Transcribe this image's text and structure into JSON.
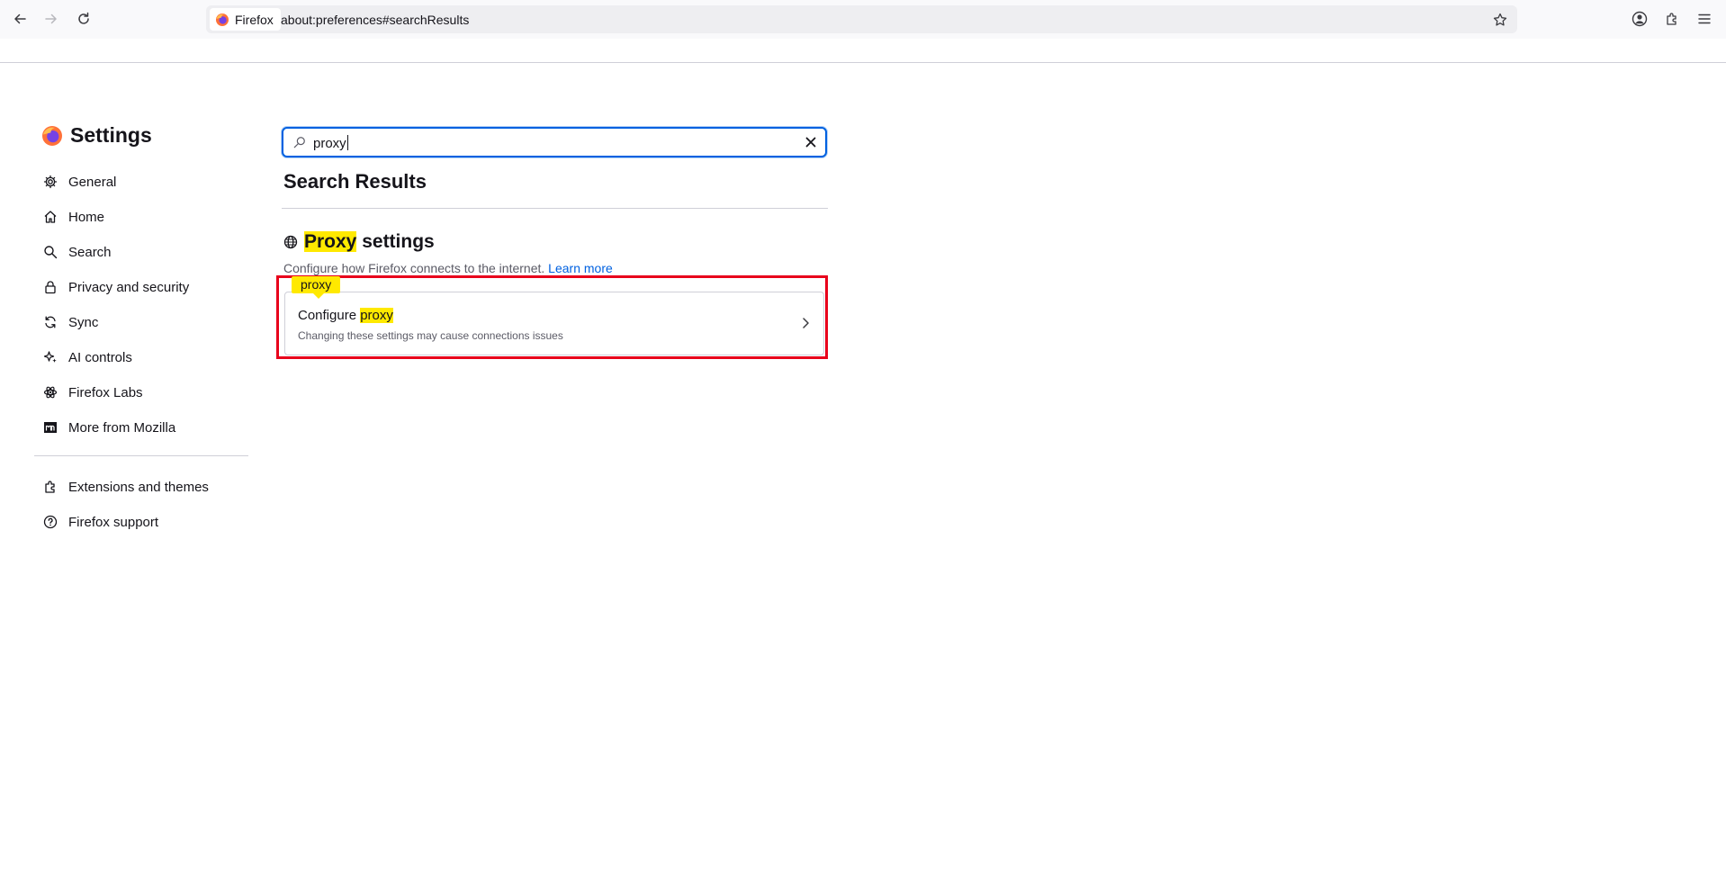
{
  "browser": {
    "identity_label": "Firefox",
    "url": "about:preferences#searchResults"
  },
  "sidebar": {
    "title": "Settings",
    "items": [
      {
        "label": "General",
        "icon": "gear-icon"
      },
      {
        "label": "Home",
        "icon": "home-icon"
      },
      {
        "label": "Search",
        "icon": "search-icon"
      },
      {
        "label": "Privacy and security",
        "icon": "lock-icon"
      },
      {
        "label": "Sync",
        "icon": "sync-icon"
      },
      {
        "label": "AI controls",
        "icon": "sparkle-icon"
      },
      {
        "label": "Firefox Labs",
        "icon": "atom-icon"
      },
      {
        "label": "More from Mozilla",
        "icon": "mozilla-icon"
      }
    ],
    "footer_items": [
      {
        "label": "Extensions and themes",
        "icon": "puzzle-icon"
      },
      {
        "label": "Firefox support",
        "icon": "help-icon"
      }
    ]
  },
  "search": {
    "value": "proxy"
  },
  "results": {
    "title": "Search Results",
    "group": {
      "title_highlight": "Proxy",
      "title_rest": " settings",
      "description": "Configure how Firefox connects to the internet.",
      "learn_more": "Learn more"
    },
    "tooltip": "proxy",
    "card": {
      "title_prefix": "Configure ",
      "title_highlight": "proxy",
      "description": "Changing these settings may cause connections issues"
    }
  },
  "colors": {
    "accent": "#0061e0",
    "highlight": "#ffe900",
    "annotation_box": "#e8001b"
  }
}
